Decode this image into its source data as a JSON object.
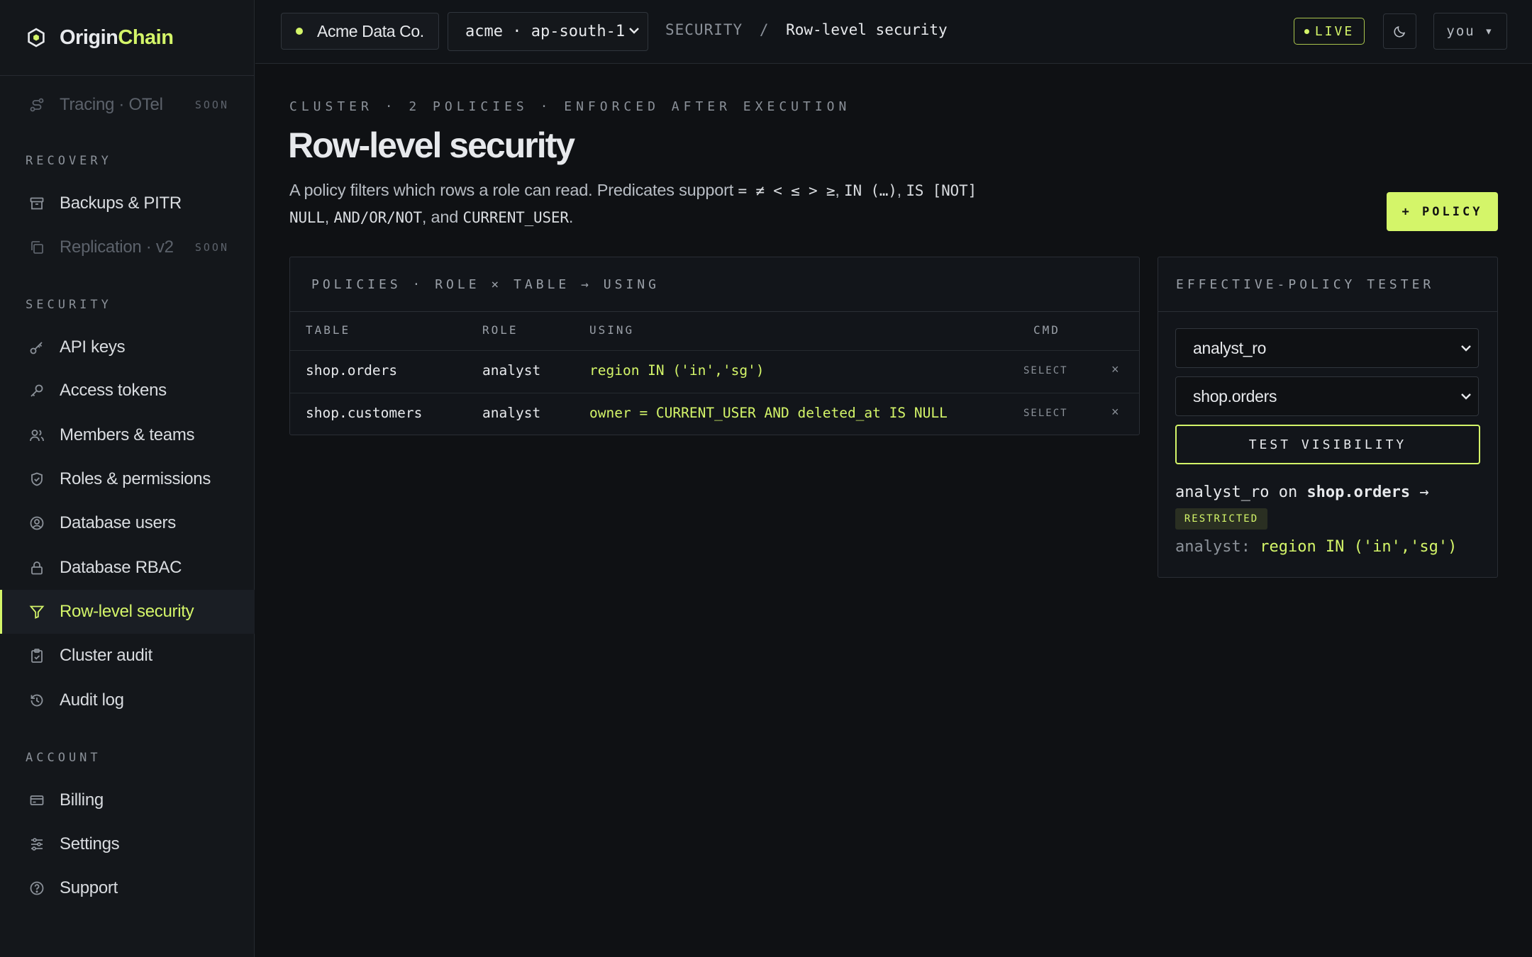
{
  "brand": {
    "name_main": "Origin",
    "name_accent": "Chain"
  },
  "sidebar": {
    "tracing": {
      "label": "Tracing · OTel",
      "badge": "SOON"
    },
    "sections": {
      "recovery": "RECOVERY",
      "security": "SECURITY",
      "account": "ACCOUNT"
    },
    "recovery_items": [
      {
        "label": "Backups & PITR"
      },
      {
        "label": "Replication · v2",
        "badge": "SOON"
      }
    ],
    "security_items": [
      {
        "label": "API keys"
      },
      {
        "label": "Access tokens"
      },
      {
        "label": "Members & teams"
      },
      {
        "label": "Roles & permissions"
      },
      {
        "label": "Database users"
      },
      {
        "label": "Database RBAC"
      },
      {
        "label": "Row-level security"
      },
      {
        "label": "Cluster audit"
      },
      {
        "label": "Audit log"
      }
    ],
    "account_items": [
      {
        "label": "Billing"
      },
      {
        "label": "Settings"
      },
      {
        "label": "Support"
      }
    ]
  },
  "topbar": {
    "org": "Acme Data Co.",
    "cluster": "acme · ap-south-1",
    "crumb_section": "SECURITY",
    "crumb_sep": "/",
    "crumb_current": "Row-level security",
    "live": "LIVE",
    "user": "you ▾"
  },
  "page": {
    "eyebrow": "CLUSTER · 2 POLICIES · ENFORCED AFTER EXECUTION",
    "title": "Row-level security",
    "desc_prefix": "A policy filters which rows a role can read. Predicates support ",
    "desc_ops": "= ≠ < ≤ > ≥",
    "desc_sep1": ", ",
    "desc_in": "IN (…)",
    "desc_sep2": ", ",
    "desc_is": "IS [NOT] NULL",
    "desc_sep3": ", ",
    "desc_logic": "AND/OR/NOT",
    "desc_and": ", and ",
    "desc_cu": "CURRENT_USER",
    "desc_end": ".",
    "add_button": "+ POLICY"
  },
  "policies": {
    "header": "POLICIES · ROLE × TABLE → USING",
    "columns": {
      "table": "TABLE",
      "role": "ROLE",
      "using": "USING",
      "cmd": "CMD"
    },
    "rows": [
      {
        "table": "shop.orders",
        "role": "analyst",
        "using": "region IN ('in','sg')",
        "cmd": "SELECT",
        "remove": "×"
      },
      {
        "table": "shop.customers",
        "role": "analyst",
        "using": "owner = CURRENT_USER AND deleted_at IS NULL",
        "cmd": "SELECT",
        "remove": "×"
      }
    ]
  },
  "tester": {
    "header": "EFFECTIVE-POLICY TESTER",
    "role_value": "analyst_ro",
    "table_value": "shop.orders",
    "button": "TEST VISIBILITY",
    "result_role": "analyst_ro",
    "result_on": " on ",
    "result_table": "shop.orders",
    "result_arrow": " →",
    "badge": "RESTRICTED",
    "detail_role": "analyst: ",
    "detail_using": "region IN ('in','sg')"
  },
  "colors": {
    "accent": "#d4f569",
    "background": "#0f1114",
    "sidebar": "#14171b"
  }
}
